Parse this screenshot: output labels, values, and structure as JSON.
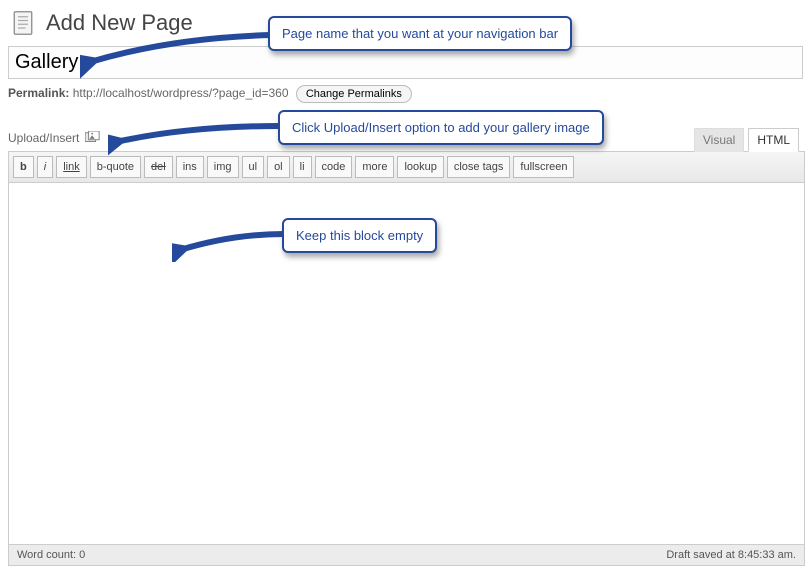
{
  "header": {
    "title": "Add New Page"
  },
  "title": {
    "value": "Gallery"
  },
  "permalink": {
    "label": "Permalink:",
    "url": "http://localhost/wordpress/?page_id=360",
    "button": "Change Permalinks"
  },
  "media": {
    "label": "Upload/Insert"
  },
  "tabs": {
    "visual": "Visual",
    "html": "HTML"
  },
  "toolbar": [
    "b",
    "i",
    "link",
    "b-quote",
    "del",
    "ins",
    "img",
    "ul",
    "ol",
    "li",
    "code",
    "more",
    "lookup",
    "close tags",
    "fullscreen"
  ],
  "editor": {
    "content": ""
  },
  "status": {
    "wordcount_label": "Word count:",
    "wordcount": "0",
    "saved": "Draft saved at 8:45:33 am."
  },
  "callouts": [
    {
      "text": "Page name that you want at your navigation bar"
    },
    {
      "text": "Click Upload/Insert option to add your gallery image"
    },
    {
      "text": "Keep this block empty"
    }
  ]
}
